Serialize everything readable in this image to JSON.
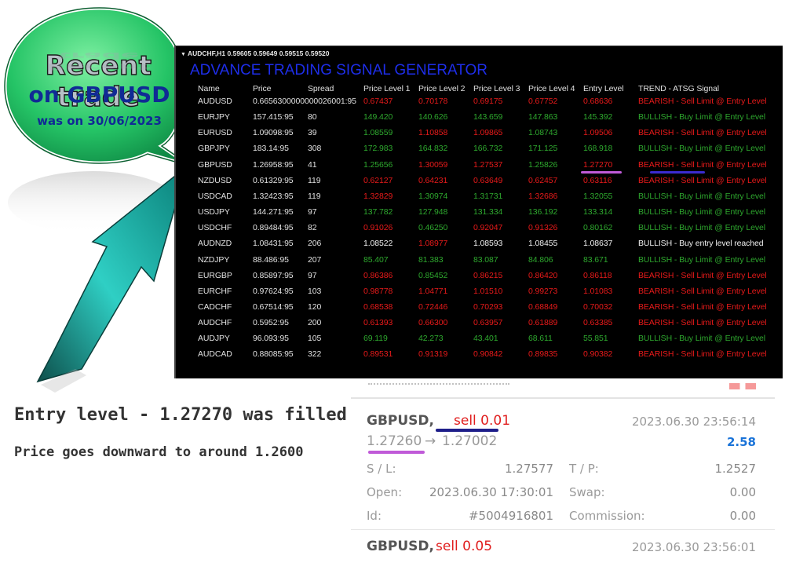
{
  "bubble": {
    "title": "Recent trade",
    "line2": "on GBPUSD",
    "line3": "was on 30/06/2023"
  },
  "terminal": {
    "header": "AUDCHF,H1  0.59605 0.59649 0.59515 0.59520",
    "title": "ADVANCE TRADING SIGNAL GENERATOR",
    "columns": [
      "Name",
      "Price",
      "Spread",
      "Price Level 1",
      "Price Level 2",
      "Price Level 3",
      "Price Level 4",
      "Entry Level",
      "TREND - ATSG Signal"
    ],
    "rows": [
      {
        "name": "AUDUSD",
        "price": "0.66563000000000",
        "spread": "",
        "spread_overlap": "0.6656300000000026001:95",
        "l1": "0.67437",
        "l2": "0.70178",
        "l3": "0.69175",
        "l4": "0.67752",
        "entry": "0.68636",
        "trend": "BEARISH - Sell Limit @ Entry Level",
        "color": "red"
      },
      {
        "name": "EURJPY",
        "price": "157.415:95",
        "spread": "80",
        "l1": "149.420",
        "l2": "140.626",
        "l3": "143.659",
        "l4": "147.863",
        "entry": "145.392",
        "trend": "BULLISH - Buy Limit @ Entry Level",
        "color": "green"
      },
      {
        "name": "EURUSD",
        "price": "1.09098:95",
        "spread": "39",
        "l1": "1.08559",
        "l2": "1.10858",
        "l3": "1.09865",
        "l4": "1.08743",
        "entry": "1.09506",
        "trend": "BEARISH - Sell Limit @ Entry Level",
        "color": "mixed1"
      },
      {
        "name": "GBPJPY",
        "price": "183.14:95",
        "spread": "308",
        "l1": "172.983",
        "l2": "164.832",
        "l3": "166.732",
        "l4": "171.125",
        "entry": "168.918",
        "trend": "BULLISH - Buy Limit @ Entry Level",
        "color": "green"
      },
      {
        "name": "GBPUSD",
        "price": "1.26958:95",
        "spread": "41",
        "l1": "1.25656",
        "l2": "1.30059",
        "l3": "1.27537",
        "l4": "1.25826",
        "entry": "1.27270",
        "trend": "BEARISH - Sell Limit @ Entry Level",
        "color": "mixed2"
      },
      {
        "name": "NZDUSD",
        "price": "0.61329:95",
        "spread": "119",
        "l1": "0.62127",
        "l2": "0.64231",
        "l3": "0.63649",
        "l4": "0.62457",
        "entry": "0.63116",
        "trend": "BEARISH - Sell Limit @ Entry Level",
        "color": "red"
      },
      {
        "name": "USDCAD",
        "price": "1.32423:95",
        "spread": "119",
        "l1": "1.32829",
        "l2": "1.30974",
        "l3": "1.31731",
        "l4": "1.32686",
        "entry": "1.32055",
        "trend": "BULLISH - Buy Limit @ Entry Level",
        "color": "mixed3"
      },
      {
        "name": "USDJPY",
        "price": "144.271:95",
        "spread": "97",
        "l1": "137.782",
        "l2": "127.948",
        "l3": "131.334",
        "l4": "136.192",
        "entry": "133.314",
        "trend": "BULLISH - Buy Limit @ Entry Level",
        "color": "green"
      },
      {
        "name": "USDCHF",
        "price": "0.89484:95",
        "spread": "82",
        "l1": "0.91026",
        "l2": "0.46250",
        "l3": "0.92047",
        "l4": "0.91326",
        "entry": "0.80162",
        "trend": "BULLISH - Buy Limit @ Entry Level",
        "color": "mixed4"
      },
      {
        "name": "AUDNZD",
        "price": "1.08431:95",
        "spread": "206",
        "l1": "1.08522",
        "l2": "1.08977",
        "l3": "1.08593",
        "l4": "1.08455",
        "entry": "1.08637",
        "trend": "BULLISH - Buy entry level reached",
        "color": "mixed5"
      },
      {
        "name": "NZDJPY",
        "price": "88.486:95",
        "spread": "207",
        "l1": "85.407",
        "l2": "81.383",
        "l3": "83.087",
        "l4": "84.806",
        "entry": "83.671",
        "trend": "BULLISH - Buy Limit @ Entry Level",
        "color": "green"
      },
      {
        "name": "EURGBP",
        "price": "0.85897:95",
        "spread": "97",
        "l1": "0.86386",
        "l2": "0.85452",
        "l3": "0.86215",
        "l4": "0.86420",
        "entry": "0.86118",
        "trend": "BEARISH - Sell Limit @ Entry Level",
        "color": "mixed6"
      },
      {
        "name": "EURCHF",
        "price": "0.97624:95",
        "spread": "103",
        "l1": "0.98778",
        "l2": "1.04771",
        "l3": "1.01510",
        "l4": "0.99273",
        "entry": "1.01083",
        "trend": "BEARISH - Sell Limit @ Entry Level",
        "color": "red"
      },
      {
        "name": "CADCHF",
        "price": "0.67514:95",
        "spread": "120",
        "l1": "0.68538",
        "l2": "0.72446",
        "l3": "0.70293",
        "l4": "0.68849",
        "entry": "0.70032",
        "trend": "BEARISH - Sell Limit @ Entry Level",
        "color": "red"
      },
      {
        "name": "AUDCHF",
        "price": "0.5952:95",
        "spread": "200",
        "l1": "0.61393",
        "l2": "0.66300",
        "l3": "0.63957",
        "l4": "0.61889",
        "entry": "0.63385",
        "trend": "BEARISH - Sell Limit @ Entry Level",
        "color": "red"
      },
      {
        "name": "AUDJPY",
        "price": "96.093:95",
        "spread": "105",
        "l1": "69.119",
        "l2": "42.273",
        "l3": "43.401",
        "l4": "68.611",
        "entry": "55.851",
        "trend": "BULLISH - Buy Limit @ Entry Level",
        "color": "green"
      },
      {
        "name": "AUDCAD",
        "price": "0.88085:95",
        "spread": "322",
        "l1": "0.89531",
        "l2": "0.91319",
        "l3": "0.90842",
        "l4": "0.89835",
        "entry": "0.90382",
        "trend": "BEARISH - Sell Limit @ Entry Level",
        "color": "red"
      }
    ]
  },
  "order": {
    "symbol": "GBPUSD,",
    "side": "sell 0.01",
    "time": "2023.06.30 23:56:14",
    "open_price": "1.27260",
    "arrow": "→",
    "close_price": "1.27002",
    "profit": "2.58",
    "fields": [
      {
        "label": "S / L:",
        "value": "1.27577",
        "label2": "T / P:",
        "value2": "1.2527"
      },
      {
        "label": "Open:",
        "value": "2023.06.30 17:30:01",
        "label2": "Swap:",
        "value2": "0.00"
      },
      {
        "label": "Id:",
        "value": "#5004916801",
        "label2": "Commission:",
        "value2": "0.00"
      }
    ],
    "next_symbol": "GBPUSD,",
    "next_side": "sell 0.05",
    "next_time": "2023.06.30 23:56:01"
  },
  "notes": {
    "line1": "Entry level - 1.27270 was filled",
    "line2": "Price goes downward to around 1.2600"
  },
  "colors": {
    "bubble_green": "#1fb35a",
    "arrow_teal": "#2fcfc4",
    "sell_red": "#e01e1e",
    "buy_green": "#2ea82e",
    "profit_blue": "#1a73d8",
    "underline_purple": "#c05ad8",
    "underline_navy": "#1e1e8a"
  }
}
